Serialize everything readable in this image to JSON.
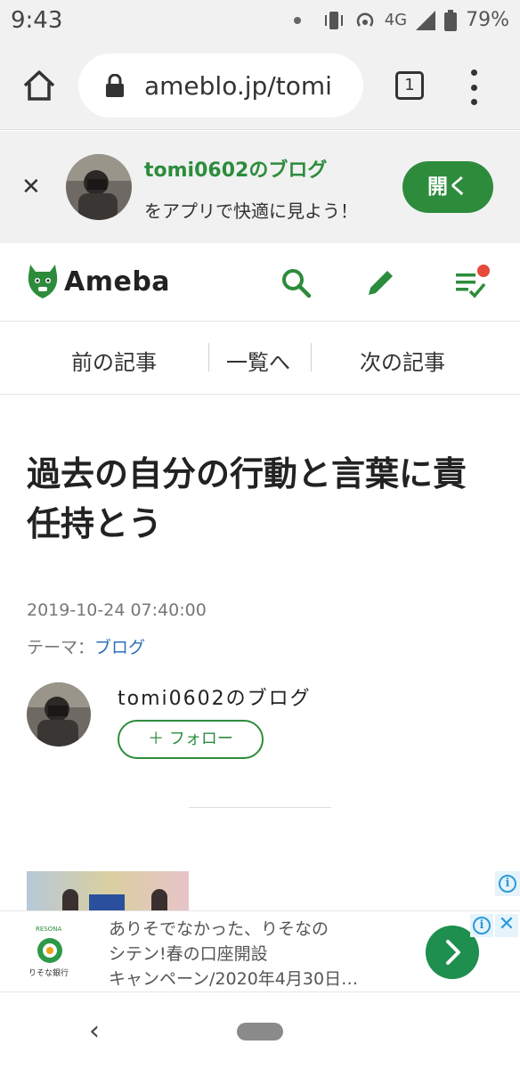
{
  "status_bar": {
    "time": "9:43",
    "network": "4G",
    "battery": "79%",
    "icons": [
      "notification-dot",
      "vibrate-icon",
      "hotspot-icon",
      "signal-icon",
      "battery-icon"
    ]
  },
  "browser": {
    "url": "ameblo.jp/tomi",
    "tab_count": "1",
    "icons": [
      "home-icon",
      "lock-icon",
      "tabs-icon",
      "more-icon"
    ]
  },
  "app_banner": {
    "title": "tomi0602のブログ",
    "subtitle": "をアプリで快適に見よう！",
    "open_label": "開く",
    "close_label": "✕",
    "accent": "#2d8c3c"
  },
  "header": {
    "logo_text": "Ameba",
    "icons": [
      "ameba-logo-icon",
      "search-icon",
      "pencil-icon",
      "feed-list-icon"
    ],
    "notification_color": "#e64a3b"
  },
  "nav": {
    "prev": "前の記事",
    "list": "一覧へ",
    "next": "次の記事"
  },
  "article": {
    "title": "過去の自分の行動と言葉に責任持とう",
    "date": "2019-10-24 07:40:00",
    "theme_label": "テーマ：",
    "theme_link": "ブログ"
  },
  "author": {
    "name": "tomi0602のブログ",
    "follow_label": "＋ フォロー"
  },
  "bottom_ad": {
    "bank_tag": "RESONA",
    "bank_name": "りそな銀行",
    "lines": [
      "ありそでなかった、りそなの",
      "シテン!春の口座開設",
      "キャンペーン/2020年4月30日…"
    ],
    "info_label": "i",
    "close_label": "✕"
  },
  "system_nav": {
    "back_label": "‹"
  }
}
